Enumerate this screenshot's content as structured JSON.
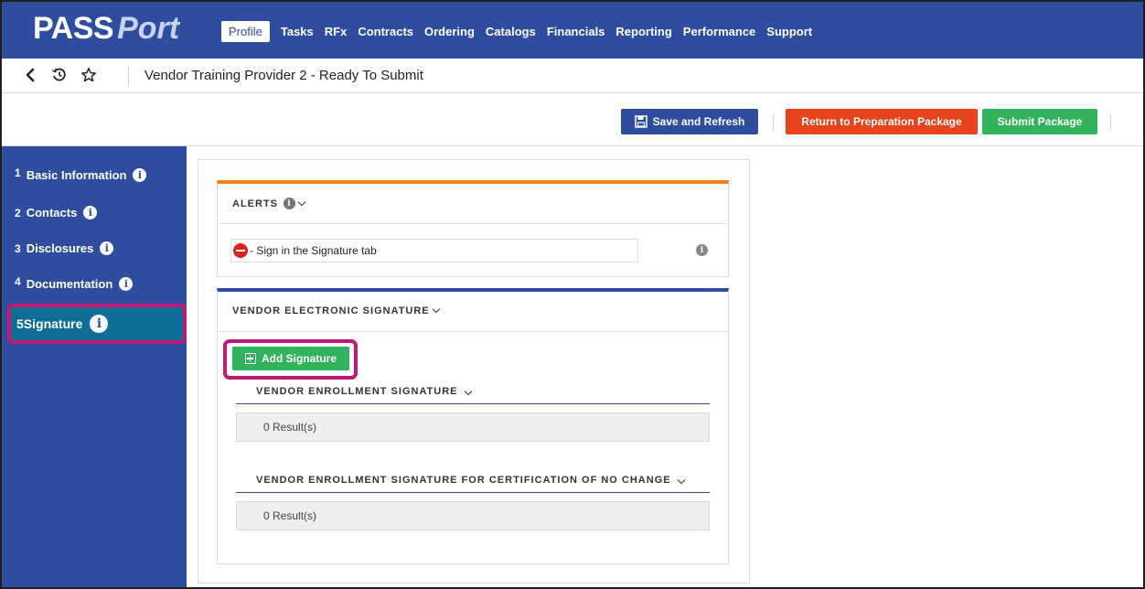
{
  "brand": {
    "part1": "PASS",
    "part2": "Port"
  },
  "nav": {
    "items": [
      {
        "label": "Profile",
        "active": true
      },
      {
        "label": "Tasks"
      },
      {
        "label": "RFx"
      },
      {
        "label": "Contracts"
      },
      {
        "label": "Ordering"
      },
      {
        "label": "Catalogs"
      },
      {
        "label": "Financials"
      },
      {
        "label": "Reporting"
      },
      {
        "label": "Performance"
      },
      {
        "label": "Support"
      }
    ]
  },
  "breadcrumb": {
    "title": "Vendor Training Provider 2 - Ready To Submit"
  },
  "actions": {
    "save_label": "Save and Refresh",
    "return_label": "Return to Preparation Package",
    "submit_label": "Submit Package"
  },
  "sidebar": {
    "items": [
      {
        "num": "1",
        "label": "Basic Information"
      },
      {
        "num": "2",
        "label": "Contacts"
      },
      {
        "num": "3",
        "label": "Disclosures"
      },
      {
        "num": "4",
        "label": "Documentation"
      },
      {
        "num": "5",
        "label": "Signature",
        "active": true
      }
    ]
  },
  "alerts": {
    "title": "ALERTS",
    "message": "- Sign in the Signature tab"
  },
  "signature": {
    "title": "VENDOR ELECTRONIC SIGNATURE",
    "add_label": "Add Signature",
    "sections": [
      {
        "title": "VENDOR ENROLLMENT SIGNATURE",
        "result": "0 Result(s)"
      },
      {
        "title": "VENDOR ENROLLMENT SIGNATURE FOR CERTIFICATION OF NO CHANGE",
        "result": "0 Result(s)"
      }
    ]
  },
  "colors": {
    "brand_blue": "#2e4d9e",
    "alert_orange": "#f07f1a",
    "danger_red": "#e8431c",
    "success_green": "#31b25d",
    "highlight_magenta": "#c21a72"
  }
}
